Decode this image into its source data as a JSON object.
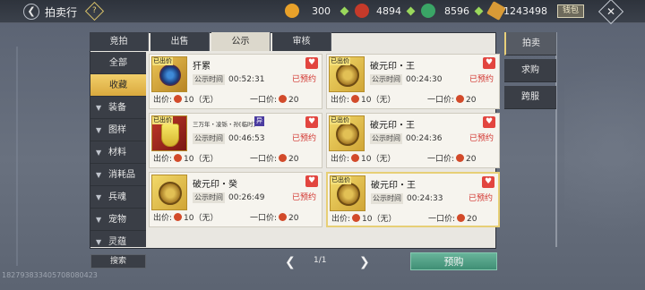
{
  "header": {
    "back_icon": "arrow-left-icon",
    "title": "拍卖行",
    "help_label": "?",
    "currencies": [
      {
        "icon": "gold-ingot-icon",
        "value": "300",
        "color": "#e8a12a"
      },
      {
        "icon": "red-coin-icon",
        "value": "4894",
        "color": "#c53a2a"
      },
      {
        "icon": "jade-icon",
        "value": "8596",
        "color": "#3aa566"
      },
      {
        "icon": "silver-leaf-icon",
        "value": "1243498",
        "color": "#d89a36"
      }
    ],
    "coin_button": "钱包",
    "close": "✕"
  },
  "tabs": [
    {
      "label": "竞拍"
    },
    {
      "label": "出售"
    },
    {
      "label": "公示",
      "active": true
    },
    {
      "label": "审核"
    }
  ],
  "sidebar": {
    "items": [
      {
        "label": "全部"
      },
      {
        "label": "收藏",
        "selected": true
      },
      {
        "label": "装备"
      },
      {
        "label": "图样"
      },
      {
        "label": "材料"
      },
      {
        "label": "消耗品"
      },
      {
        "label": "兵魂"
      },
      {
        "label": "宠物"
      },
      {
        "label": "灵蕴"
      }
    ],
    "search": "搜索"
  },
  "cards": [
    {
      "tag": "已出价",
      "name": "犴累",
      "time_label": "公示时间",
      "time": "00:52:31",
      "status": "已预约",
      "bid_label": "出价:",
      "bid": "10（无）",
      "buy_label": "一口价:",
      "buy": "20",
      "icon": "gem-icon"
    },
    {
      "tag": "已出价",
      "name": "破元印・王",
      "time_label": "公示时间",
      "time": "00:24:30",
      "status": "已预约",
      "bid_label": "出价:",
      "bid": "10（无）",
      "buy_label": "一口价:",
      "buy": "20",
      "icon": "seal-icon"
    },
    {
      "tag": "已出价",
      "name": "三万年・凌铄・孙[临时]",
      "badge": "异",
      "time_label": "公示时间",
      "time": "00:46:53",
      "status": "已预约",
      "bid_label": "出价:",
      "bid": "10（无）",
      "buy_label": "一口价:",
      "buy": "20",
      "icon": "shield-icon"
    },
    {
      "tag": "已出价",
      "name": "破元印・王",
      "time_label": "公示时间",
      "time": "00:24:36",
      "status": "已预约",
      "bid_label": "出价:",
      "bid": "10（无）",
      "buy_label": "一口价:",
      "buy": "20",
      "icon": "seal-icon"
    },
    {
      "tag": "",
      "name": "破元印・癸",
      "time_label": "公示时间",
      "time": "00:26:49",
      "status": "已预约",
      "bid_label": "出价:",
      "bid": "10（无）",
      "buy_label": "一口价:",
      "buy": "20",
      "icon": "seal-icon"
    },
    {
      "tag": "已出价",
      "name": "破元印・王",
      "time_label": "公示时间",
      "time": "00:24:33",
      "status": "已预约",
      "bid_label": "出价:",
      "bid": "10（无）",
      "buy_label": "一口价:",
      "buy": "20",
      "icon": "seal-icon",
      "highlighted": true
    }
  ],
  "pager": {
    "text": "1/1"
  },
  "reserve_button": "预购",
  "right_tabs": [
    {
      "label": "拍卖",
      "active": true
    },
    {
      "label": "求购"
    },
    {
      "label": "跨服"
    }
  ],
  "uid": "1827938334057080804​23"
}
